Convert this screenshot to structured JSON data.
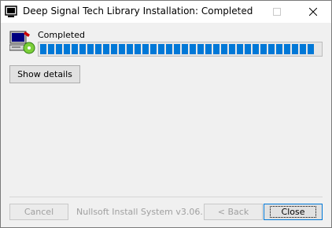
{
  "window": {
    "title": "Deep Signal Tech Library Installation: Completed"
  },
  "titlebar_icons": {
    "app": "installer-window-icon",
    "minimize": "minimize-icon",
    "maximize": "maximize-icon",
    "close": "close-icon"
  },
  "status": {
    "text": "Completed",
    "icon": "computer-installer-icon",
    "progress_percent": 100
  },
  "buttons": {
    "show_details": "Show details",
    "cancel": "Cancel",
    "back": "< Back",
    "close": "Close"
  },
  "footer": {
    "brand": "Nullsoft Install System v3.06.1"
  },
  "colors": {
    "progress": "#0078d7",
    "panel": "#f0f0f0"
  }
}
